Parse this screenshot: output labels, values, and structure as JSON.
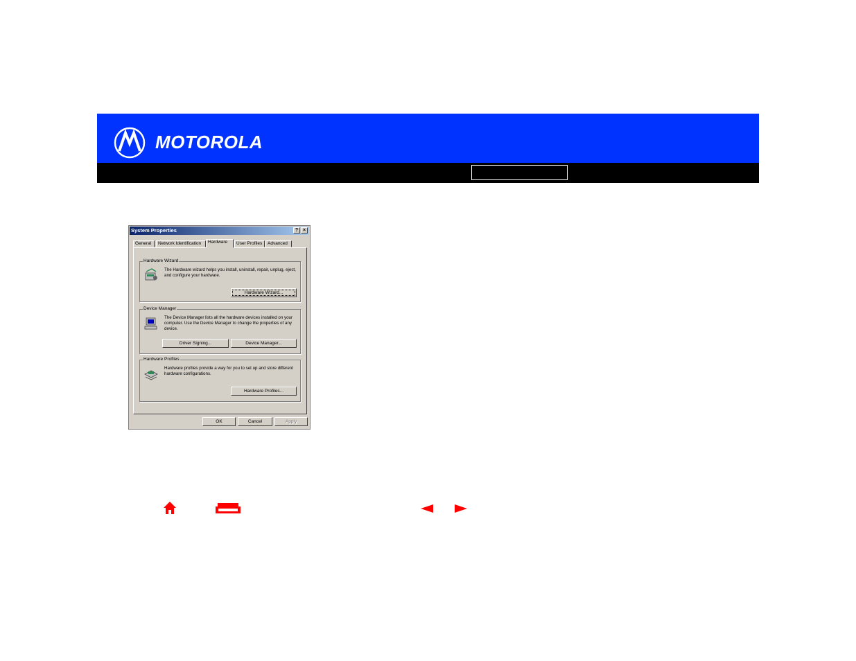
{
  "brand": {
    "name": "MOTOROLA",
    "accent": "#0033ff",
    "nav_color": "#ff0000"
  },
  "dialog": {
    "title": "System Properties",
    "help_label": "?",
    "close_label": "×",
    "tabs": [
      {
        "label": "General"
      },
      {
        "label": "Network Identification"
      },
      {
        "label": "Hardware"
      },
      {
        "label": "User Profiles"
      },
      {
        "label": "Advanced"
      }
    ],
    "active_tab": "Hardware",
    "hardware_wizard": {
      "title": "Hardware Wizard",
      "text": "The Hardware wizard helps you install, uninstall, repair, unplug, eject, and configure your hardware.",
      "button": "Hardware Wizard..."
    },
    "device_manager": {
      "title": "Device Manager",
      "text": "The Device Manager lists all the hardware devices installed on your computer. Use the Device Manager to change the properties of any device.",
      "button_driver": "Driver Signing...",
      "button_device": "Device Manager..."
    },
    "hardware_profiles": {
      "title": "Hardware Profiles",
      "text": "Hardware profiles provide a way for you to set up and store different hardware configurations.",
      "button": "Hardware Profiles..."
    },
    "buttons": {
      "ok": "OK",
      "cancel": "Cancel",
      "apply": "Apply"
    }
  },
  "footer_nav": {
    "icons": [
      "home-icon",
      "print-icon",
      "previous-arrow-icon",
      "next-arrow-icon"
    ]
  }
}
